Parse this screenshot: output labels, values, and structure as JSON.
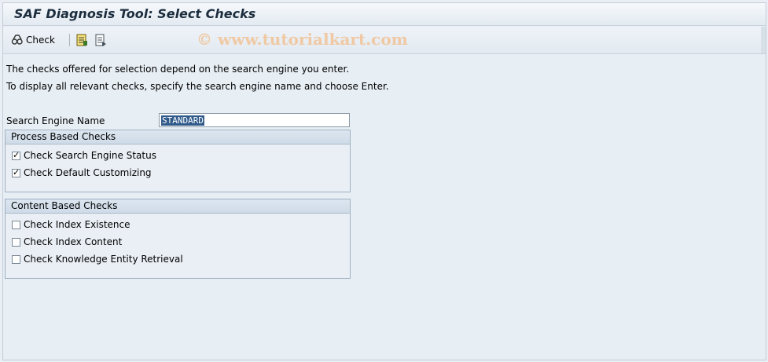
{
  "window": {
    "title": "SAF Diagnosis Tool: Select Checks",
    "watermark": "© www.tutorialkart.com"
  },
  "toolbar": {
    "check_label": "Check",
    "icons": [
      "check-execute-icon",
      "variant-icon",
      "save-variant-icon"
    ]
  },
  "info": {
    "line1": "The checks offered for selection depend on the search engine you enter.",
    "line2": "To display all relevant checks, specify the search engine name and choose Enter."
  },
  "search_engine": {
    "label": "Search Engine Name",
    "value": "STANDARD"
  },
  "process_group": {
    "title": "Process Based Checks",
    "items": [
      {
        "label": "Check Search Engine Status",
        "checked": true
      },
      {
        "label": "Check Default Customizing",
        "checked": true
      }
    ]
  },
  "content_group": {
    "title": "Content Based Checks",
    "items": [
      {
        "label": "Check Index Existence",
        "checked": false
      },
      {
        "label": "Check Index Content",
        "checked": false
      },
      {
        "label": "Check Knowledge Entity Retrieval",
        "checked": false
      }
    ]
  }
}
